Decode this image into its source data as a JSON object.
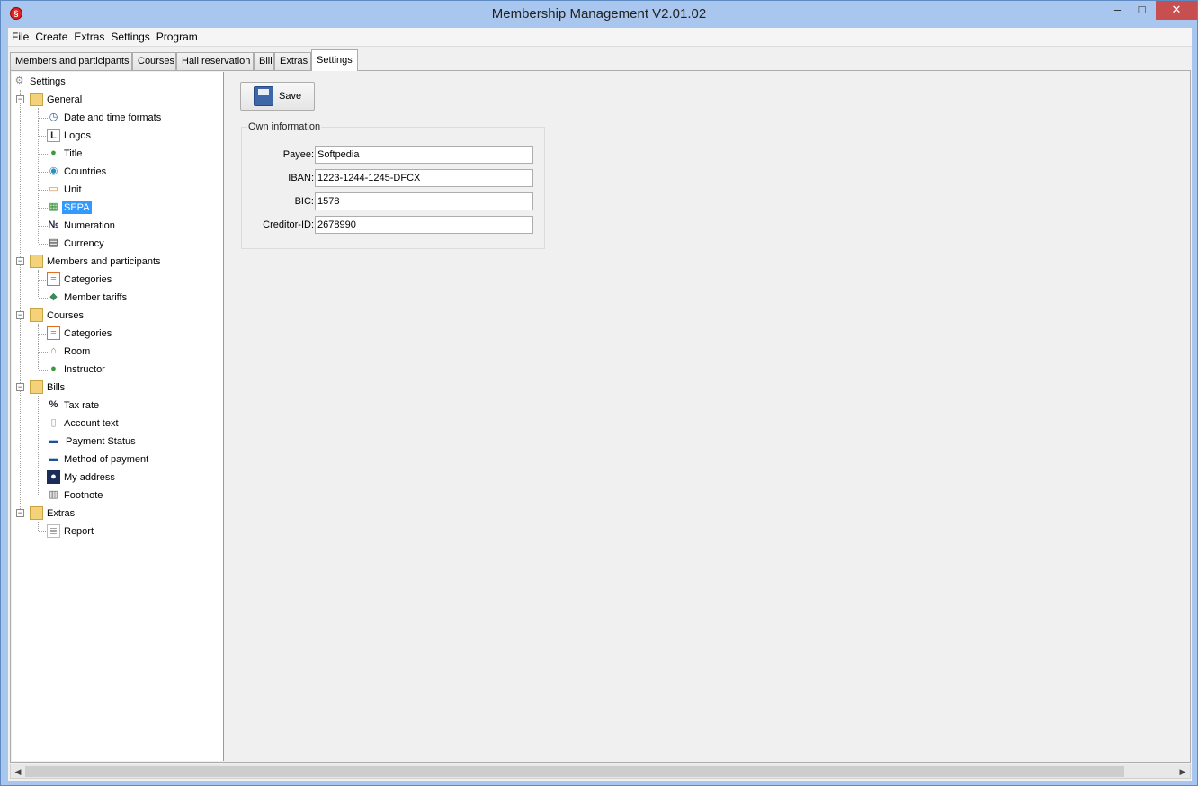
{
  "window": {
    "title": "Membership Management V2.01.02",
    "controls": {
      "minimize": "–",
      "maximize": "□",
      "close": "✕"
    }
  },
  "menu": [
    "File",
    "Create",
    "Extras",
    "Settings",
    "Program"
  ],
  "tabs": [
    "Members and participants",
    "Courses",
    "Hall reservation",
    "Bill",
    "Extras",
    "Settings"
  ],
  "active_tab": "Settings",
  "tree": {
    "root": "Settings",
    "groups": [
      {
        "label": "General",
        "items": [
          "Date and time formats",
          "Logos",
          "Title",
          "Countries",
          "Unit",
          "SEPA",
          "Numeration",
          "Currency"
        ]
      },
      {
        "label": "Members and participants",
        "items": [
          "Categories",
          "Member tariffs"
        ]
      },
      {
        "label": "Courses",
        "items": [
          "Categories",
          "Room",
          "Instructor"
        ]
      },
      {
        "label": "Bills",
        "items": [
          "Tax rate",
          "Account text",
          "Payment Status",
          "Method of payment",
          "My address",
          "Footnote"
        ]
      },
      {
        "label": "Extras",
        "items": [
          "Report"
        ]
      }
    ],
    "selected": "SEPA"
  },
  "content": {
    "save_label": "Save",
    "group_title": "Own information",
    "fields": [
      {
        "label": "Payee:",
        "value": "Softpedia"
      },
      {
        "label": "IBAN:",
        "value": "1223-1244-1245-DFCX"
      },
      {
        "label": "BIC:",
        "value": "1578"
      },
      {
        "label": "Creditor-ID:",
        "value": "2678990"
      }
    ]
  },
  "scroll": {
    "left": "◀",
    "right": "▶"
  }
}
